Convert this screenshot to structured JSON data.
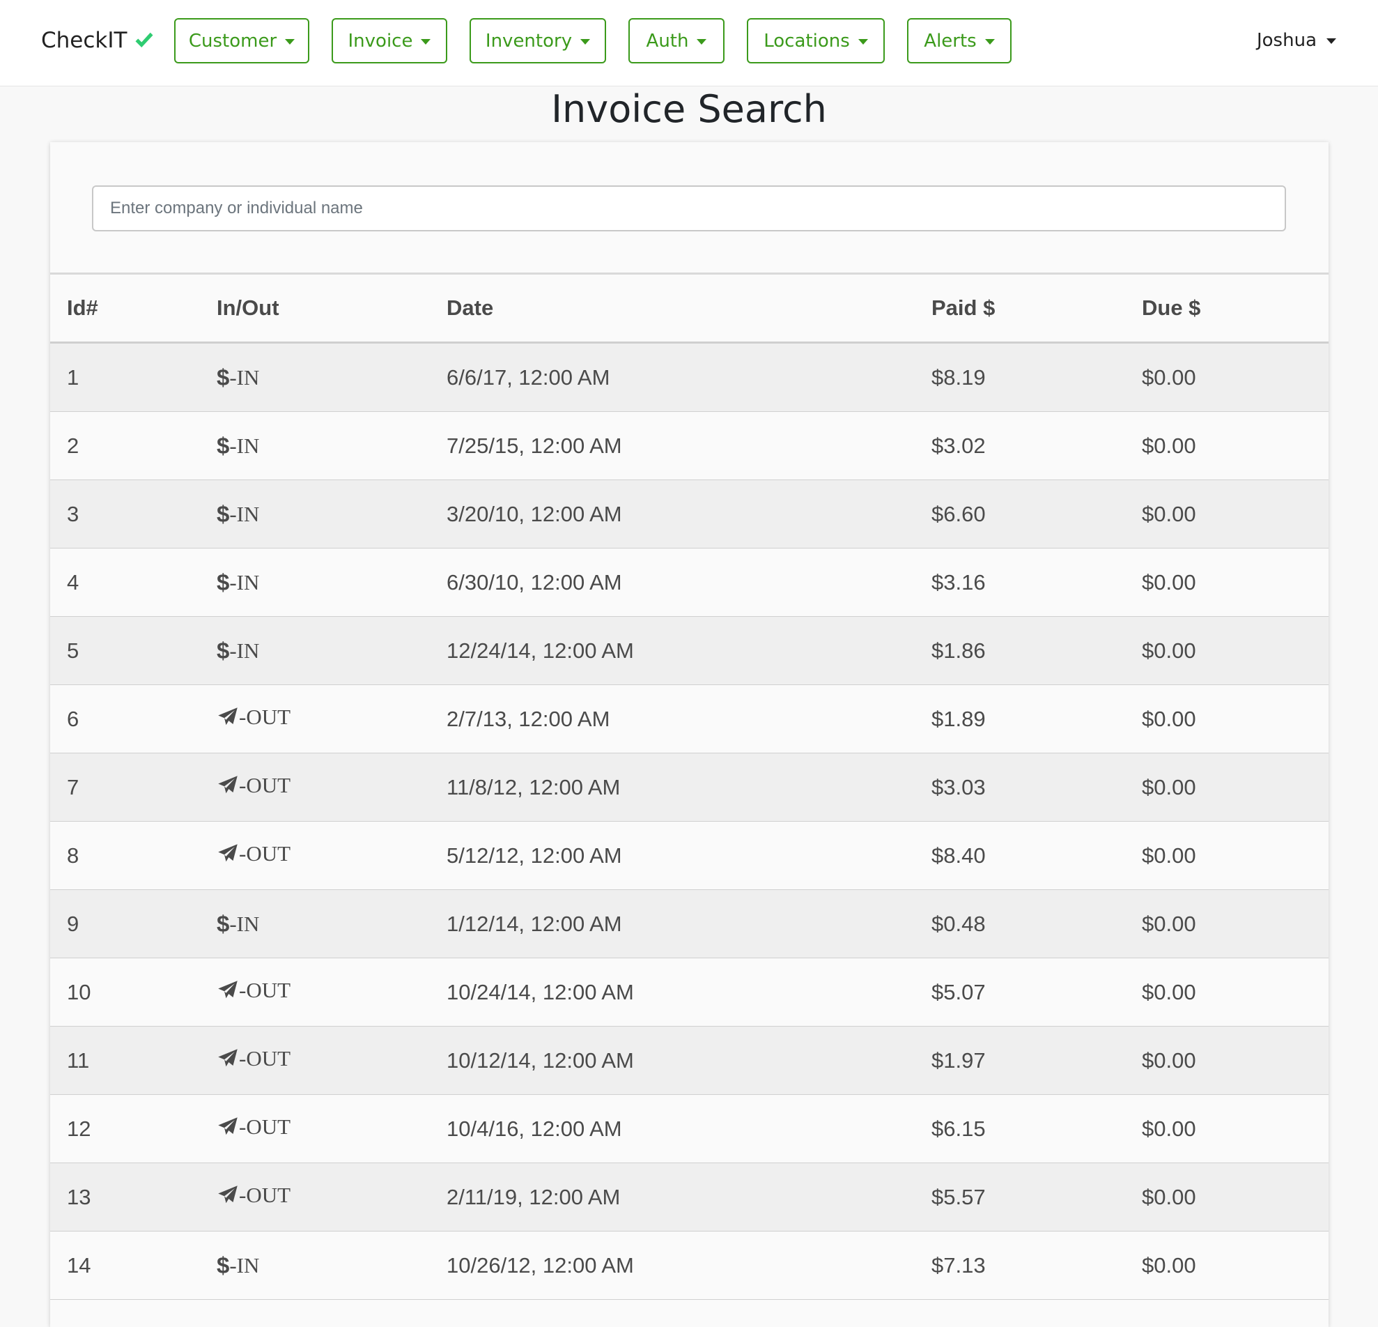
{
  "app": {
    "brand": "CheckIT",
    "brand_icon": "checkmark-icon",
    "accent_color": "#3b9a1b",
    "check_color": "#2ecc71"
  },
  "nav": {
    "menus": [
      {
        "label": "Customer"
      },
      {
        "label": "Invoice"
      },
      {
        "label": "Inventory"
      },
      {
        "label": "Auth"
      },
      {
        "label": "Locations"
      },
      {
        "label": "Alerts"
      }
    ],
    "user": "Joshua"
  },
  "page": {
    "title": "Invoice Search"
  },
  "search": {
    "placeholder": "Enter company or individual name",
    "value": ""
  },
  "table": {
    "headers": {
      "id": "Id#",
      "io": "In/Out",
      "date": "Date",
      "paid": "Paid $",
      "due": "Due $"
    },
    "rows": [
      {
        "id": "1",
        "dir": "IN",
        "io_label": "-IN",
        "icon": "dollar-icon",
        "date": "6/6/17, 12:00 AM",
        "paid": "$8.19",
        "due": "$0.00"
      },
      {
        "id": "2",
        "dir": "IN",
        "io_label": "-IN",
        "icon": "dollar-icon",
        "date": "7/25/15, 12:00 AM",
        "paid": "$3.02",
        "due": "$0.00"
      },
      {
        "id": "3",
        "dir": "IN",
        "io_label": "-IN",
        "icon": "dollar-icon",
        "date": "3/20/10, 12:00 AM",
        "paid": "$6.60",
        "due": "$0.00"
      },
      {
        "id": "4",
        "dir": "IN",
        "io_label": "-IN",
        "icon": "dollar-icon",
        "date": "6/30/10, 12:00 AM",
        "paid": "$3.16",
        "due": "$0.00"
      },
      {
        "id": "5",
        "dir": "IN",
        "io_label": "-IN",
        "icon": "dollar-icon",
        "date": "12/24/14, 12:00 AM",
        "paid": "$1.86",
        "due": "$0.00"
      },
      {
        "id": "6",
        "dir": "OUT",
        "io_label": "-OUT",
        "icon": "paper-plane-icon",
        "date": "2/7/13, 12:00 AM",
        "paid": "$1.89",
        "due": "$0.00"
      },
      {
        "id": "7",
        "dir": "OUT",
        "io_label": "-OUT",
        "icon": "paper-plane-icon",
        "date": "11/8/12, 12:00 AM",
        "paid": "$3.03",
        "due": "$0.00"
      },
      {
        "id": "8",
        "dir": "OUT",
        "io_label": "-OUT",
        "icon": "paper-plane-icon",
        "date": "5/12/12, 12:00 AM",
        "paid": "$8.40",
        "due": "$0.00"
      },
      {
        "id": "9",
        "dir": "IN",
        "io_label": "-IN",
        "icon": "dollar-icon",
        "date": "1/12/14, 12:00 AM",
        "paid": "$0.48",
        "due": "$0.00"
      },
      {
        "id": "10",
        "dir": "OUT",
        "io_label": "-OUT",
        "icon": "paper-plane-icon",
        "date": "10/24/14, 12:00 AM",
        "paid": "$5.07",
        "due": "$0.00"
      },
      {
        "id": "11",
        "dir": "OUT",
        "io_label": "-OUT",
        "icon": "paper-plane-icon",
        "date": "10/12/14, 12:00 AM",
        "paid": "$1.97",
        "due": "$0.00"
      },
      {
        "id": "12",
        "dir": "OUT",
        "io_label": "-OUT",
        "icon": "paper-plane-icon",
        "date": "10/4/16, 12:00 AM",
        "paid": "$6.15",
        "due": "$0.00"
      },
      {
        "id": "13",
        "dir": "OUT",
        "io_label": "-OUT",
        "icon": "paper-plane-icon",
        "date": "2/11/19, 12:00 AM",
        "paid": "$5.57",
        "due": "$0.00"
      },
      {
        "id": "14",
        "dir": "IN",
        "io_label": "-IN",
        "icon": "dollar-icon",
        "date": "10/26/12, 12:00 AM",
        "paid": "$7.13",
        "due": "$0.00"
      }
    ]
  }
}
